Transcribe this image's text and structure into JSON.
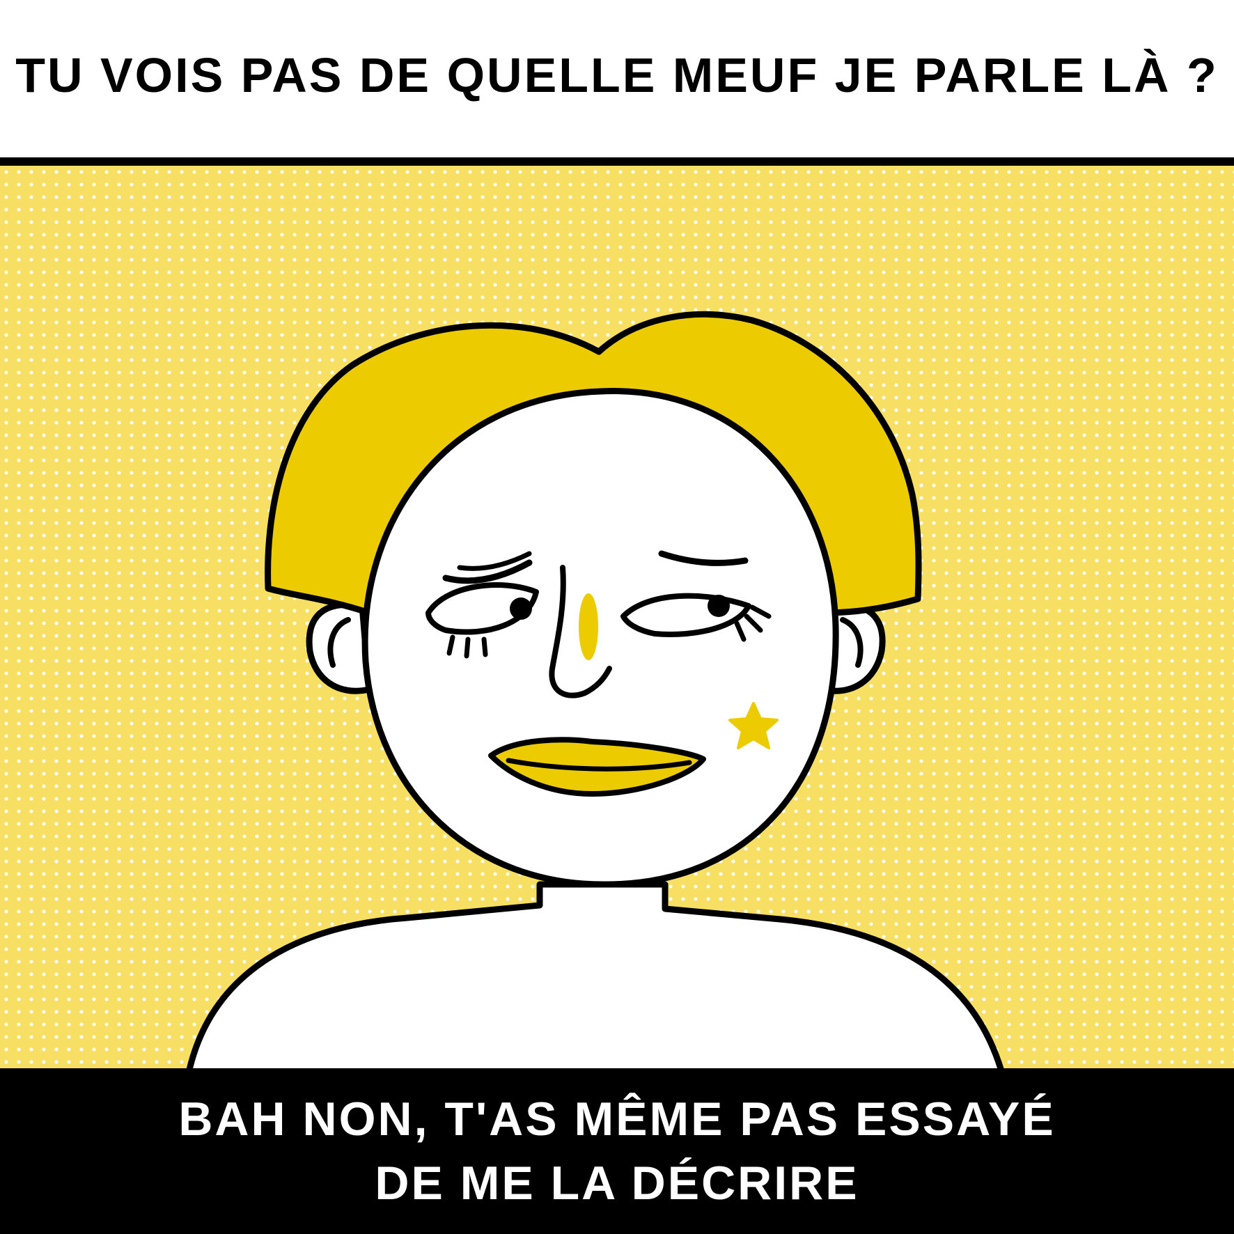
{
  "captions": {
    "top": "TU VOIS PAS DE QUELLE MEUF JE PARLE LÀ ?",
    "bottom_line_1": "BAH NON, T'AS MÊME PAS ESSAYÉ",
    "bottom_line_2": "DE ME LA DÉCRIRE"
  },
  "colors": {
    "panel_background": "#f7df63",
    "hair_and_accents": "#eccc00",
    "outline": "#000000",
    "skin": "#ffffff",
    "caption_bar": "#000000"
  },
  "illustration": {
    "subject": "woman-with-blonde-bob-portrait",
    "cheek_mark": "star-icon"
  }
}
